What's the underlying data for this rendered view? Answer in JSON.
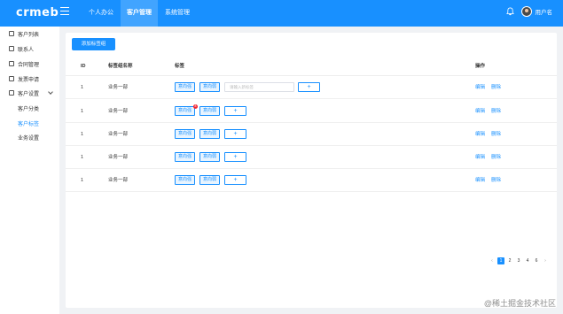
{
  "header": {
    "logo": "crmeb",
    "nav": [
      {
        "label": "个人办公",
        "active": false
      },
      {
        "label": "客户管理",
        "active": true
      },
      {
        "label": "系统管理",
        "active": false
      }
    ],
    "username": "用户名"
  },
  "sidebar": {
    "items": [
      {
        "label": "客户列表"
      },
      {
        "label": "联系人"
      },
      {
        "label": "合同管理"
      },
      {
        "label": "发票申请"
      },
      {
        "label": "客户设置"
      }
    ],
    "sub_items": [
      {
        "label": "客户分类",
        "active": false
      },
      {
        "label": "客户标签",
        "active": true
      },
      {
        "label": "业务设置",
        "active": false
      }
    ]
  },
  "main": {
    "add_button": "添加标签组",
    "columns": {
      "id": "ID",
      "name": "标签组名称",
      "tags": "标签",
      "ops": "操作"
    },
    "input_placeholder": "请输入新标签",
    "plus_label": "+",
    "badge": "8",
    "rows": [
      {
        "id": "1",
        "name": "业务一部",
        "tag1": "意向强",
        "tag2": "意向弱",
        "edit": "编辑",
        "delete": "删除"
      },
      {
        "id": "1",
        "name": "业务一部",
        "tag1": "意向强",
        "tag2": "意向弱",
        "edit": "编辑",
        "delete": "删除"
      },
      {
        "id": "1",
        "name": "业务一部",
        "tag1": "意向强",
        "tag2": "意向弱",
        "edit": "编辑",
        "delete": "删除"
      },
      {
        "id": "1",
        "name": "业务一部",
        "tag1": "意向强",
        "tag2": "意向弱",
        "edit": "编辑",
        "delete": "删除"
      },
      {
        "id": "1",
        "name": "业务一部",
        "tag1": "意向强",
        "tag2": "意向弱",
        "edit": "编辑",
        "delete": "删除"
      }
    ]
  },
  "pagination": {
    "prev": "‹",
    "pages": [
      "1",
      "2",
      "3",
      "4",
      "6"
    ],
    "current": "1",
    "next": "›"
  },
  "watermark": "@稀土掘金技术社区",
  "colors": {
    "primary": "#1890ff",
    "background": "#f0f2f5"
  }
}
